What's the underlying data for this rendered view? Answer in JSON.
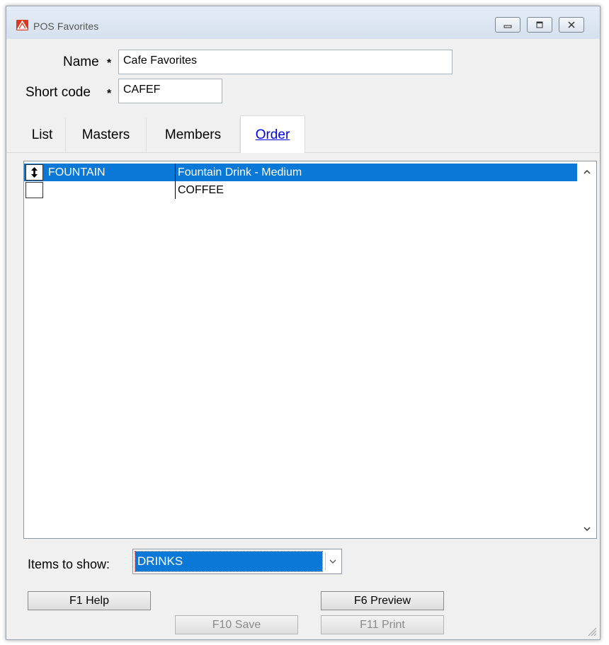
{
  "window": {
    "title": "POS Favorites",
    "controls": [
      "minimize-icon",
      "maximize-icon",
      "close-icon"
    ]
  },
  "form": {
    "name_label": "Name",
    "name_required": "*",
    "name_value": "Cafe Favorites",
    "shortcode_label": "Short code",
    "shortcode_required": "*",
    "shortcode_value": "CAFEF"
  },
  "tabs": [
    {
      "label": "List",
      "active": false
    },
    {
      "label": "Masters",
      "active": false
    },
    {
      "label": "Members",
      "active": false
    },
    {
      "label": "Order",
      "active": true
    }
  ],
  "grid": {
    "rows": [
      {
        "code": "FOUNTAIN",
        "description": "Fountain Drink - Medium",
        "selected": true,
        "handle": "up-down-arrow-icon"
      },
      {
        "code": "",
        "description": "COFFEE",
        "selected": false,
        "handle": ""
      }
    ]
  },
  "filter": {
    "label": "Items to show:",
    "value": "DRINKS"
  },
  "buttons": {
    "help": "F1 Help",
    "preview": "F6 Preview",
    "save": "F10 Save",
    "print": "F11 Print"
  },
  "colors": {
    "selection": "#0a78d7",
    "app_icon": "#d93a1f",
    "active_tab_text": "#0000ee"
  }
}
